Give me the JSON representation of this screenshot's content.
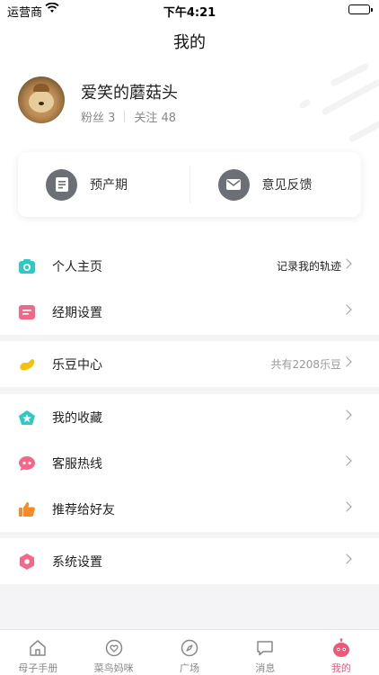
{
  "status_bar": {
    "carrier": "运营商",
    "time": "下午4:21"
  },
  "header": {
    "title": "我的"
  },
  "profile": {
    "name": "爱笑的蘑菇头",
    "fans_label": "粉丝 3",
    "follow_label": "关注 48"
  },
  "quick_actions": [
    {
      "label": "预产期",
      "icon": "document-icon"
    },
    {
      "label": "意见反馈",
      "icon": "mail-icon"
    }
  ],
  "menu": {
    "profile_page": {
      "label": "个人主页",
      "right": "记录我的轨迹"
    },
    "period_settings": {
      "label": "经期设置"
    },
    "ledou_center": {
      "label": "乐豆中心",
      "right": "共有2208乐豆"
    },
    "favorites": {
      "label": "我的收藏"
    },
    "hotline": {
      "label": "客服热线"
    },
    "recommend": {
      "label": "推荐给好友"
    },
    "settings": {
      "label": "系统设置"
    }
  },
  "tabbar": [
    {
      "label": "母子手册",
      "icon": "home-icon"
    },
    {
      "label": "菜鸟妈咪",
      "icon": "heart-icon"
    },
    {
      "label": "广场",
      "icon": "compass-icon"
    },
    {
      "label": "消息",
      "icon": "chat-icon"
    },
    {
      "label": "我的",
      "icon": "robot-icon",
      "active": true
    }
  ],
  "colors": {
    "accent": "#f0567a",
    "teal": "#2ec9c2",
    "pink": "#f2678a",
    "yellow": "#f4c20d",
    "orange": "#f58b2a"
  }
}
